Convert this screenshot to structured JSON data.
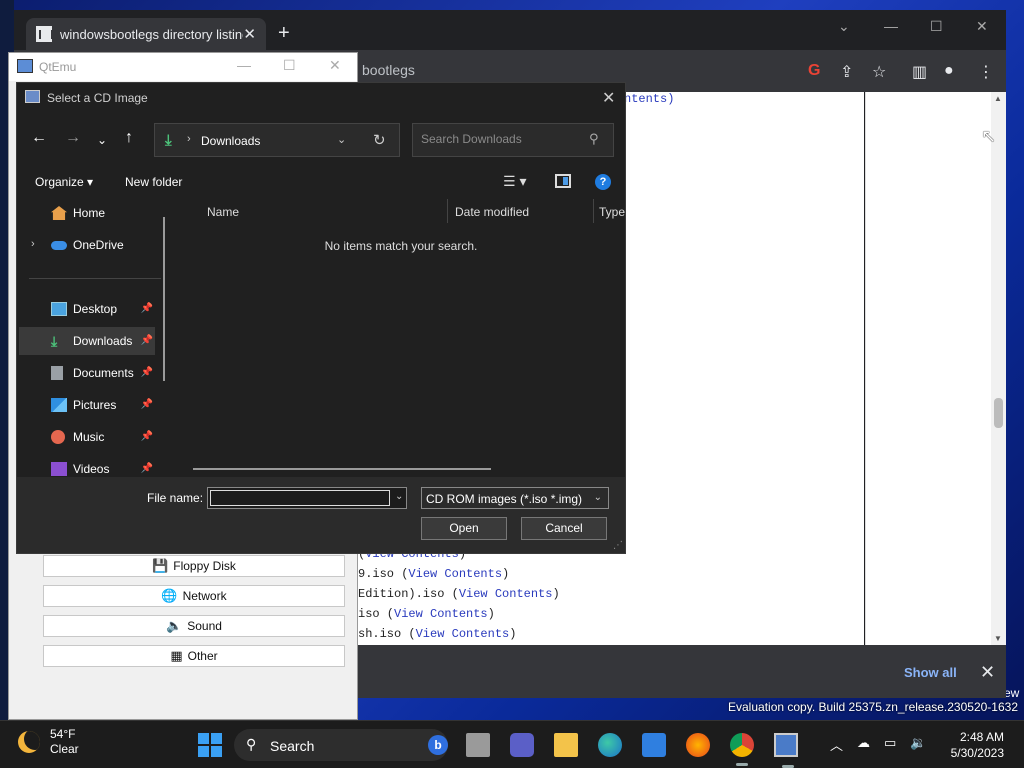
{
  "browser": {
    "tab_title": "windowsbootlegs directory listing",
    "address_fragment": "bootlegs",
    "content_top_text": "ntents)",
    "listing": [
      {
        "prefix": "(",
        "name": "",
        "link": "View Contents",
        "suffix": ")"
      },
      {
        "prefix": "9.iso (",
        "name": "",
        "link": "View Contents",
        "suffix": ")"
      },
      {
        "prefix": "Edition).iso (",
        "name": "",
        "link": "View Contents",
        "suffix": ")"
      },
      {
        "prefix": "iso (",
        "name": "",
        "link": "View Contents",
        "suffix": ")"
      },
      {
        "prefix": "sh.iso (",
        "name": "",
        "link": "View Contents",
        "suffix": ")"
      }
    ],
    "show_all_label": "Show all",
    "icons": [
      "google-icon",
      "share-icon",
      "star-icon",
      "sidepanel-icon",
      "profile-icon",
      "menu-icon"
    ]
  },
  "qtemu": {
    "title": "QtEmu",
    "buttons": [
      {
        "label": "Floppy Disk",
        "icon": "floppy-icon"
      },
      {
        "label": "Network",
        "icon": "network-icon"
      },
      {
        "label": "Sound",
        "icon": "sound-icon"
      },
      {
        "label": "Other",
        "icon": "other-icon"
      }
    ]
  },
  "dialog": {
    "title": "Select a CD Image",
    "address_label": "Downloads",
    "search_placeholder": "Search Downloads",
    "organize_label": "Organize",
    "new_folder_label": "New folder",
    "nav_items": [
      {
        "label": "Home",
        "icon": "home-icon",
        "pinned": false,
        "expander": false,
        "selected": false
      },
      {
        "label": "OneDrive",
        "icon": "onedrive-icon",
        "pinned": false,
        "expander": true,
        "selected": false
      },
      {
        "label": "Desktop",
        "icon": "desktop-icon",
        "pinned": true,
        "expander": false,
        "selected": false
      },
      {
        "label": "Downloads",
        "icon": "downloads-icon",
        "pinned": true,
        "expander": false,
        "selected": true
      },
      {
        "label": "Documents",
        "icon": "documents-icon",
        "pinned": true,
        "expander": false,
        "selected": false
      },
      {
        "label": "Pictures",
        "icon": "pictures-icon",
        "pinned": true,
        "expander": false,
        "selected": false
      },
      {
        "label": "Music",
        "icon": "music-icon",
        "pinned": true,
        "expander": false,
        "selected": false
      },
      {
        "label": "Videos",
        "icon": "videos-icon",
        "pinned": true,
        "expander": false,
        "selected": false
      }
    ],
    "columns": [
      "Name",
      "Date modified",
      "Type"
    ],
    "empty_message": "No items match your search.",
    "file_name_label": "File name:",
    "file_name_value": "",
    "filter_label": "CD ROM images (*.iso *.img)",
    "open_label": "Open",
    "cancel_label": "Cancel"
  },
  "desktop": {
    "eval_text": "Evaluation copy. Build 25375.zn_release.230520-1632",
    "edge_text": "ew"
  },
  "taskbar": {
    "weather_temp": "54°F",
    "weather_desc": "Clear",
    "search_label": "Search",
    "time": "2:48 AM",
    "date": "5/30/2023"
  },
  "colors": {
    "accent_blue": "#3aa0f3",
    "link_color": "#2a3bbd",
    "download_green": "#4cc27a",
    "dialog_bg": "#202020"
  }
}
